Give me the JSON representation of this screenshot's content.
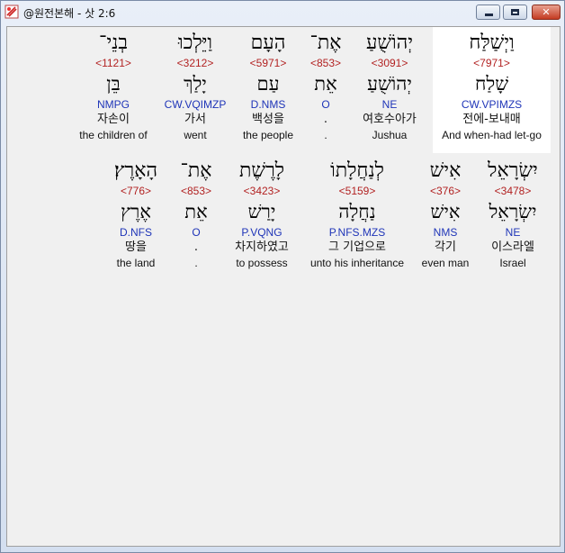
{
  "window": {
    "title": "@원전본해 - 삿 2:6",
    "buttons": {
      "minimize": "",
      "maximize": "",
      "close": "✕"
    }
  },
  "verse": {
    "row1": [
      {
        "heb": "וַיְשַׁלַּח",
        "strong": "<7971>",
        "lemma": "שָׁלַח",
        "morph": "CW.VPIMZS",
        "kor": "전에-보내매",
        "eng": "And when-had let-go"
      },
      {
        "heb": "יְהוֹשֻׁעַ",
        "strong": "<3091>",
        "lemma": "יְהוֹשֻׁעַ",
        "morph": "NE",
        "kor": "여호수아가",
        "eng": "Jushua"
      },
      {
        "heb": "אֶת־",
        "strong": "<853>",
        "lemma": "אֵת",
        "morph": "O",
        "kor": ".",
        "eng": "."
      },
      {
        "heb": "הָעָם",
        "strong": "<5971>",
        "lemma": "עַם",
        "morph": "D.NMS",
        "kor": "백성을",
        "eng": "the people"
      },
      {
        "heb": "וַיֵּלְכוּ",
        "strong": "<3212>",
        "lemma": "יָלַךְ",
        "morph": "CW.VQIMZP",
        "kor": "가서",
        "eng": "went"
      },
      {
        "heb": "בְנֵי־",
        "strong": "<1121>",
        "lemma": "בֵּן",
        "morph": "NMPG",
        "kor": "자손이",
        "eng": "the children of"
      }
    ],
    "row2": [
      {
        "heb": "יִשְׂרָאֵל",
        "strong": "<3478>",
        "lemma": "יִשְׂרָאֵל",
        "morph": "NE",
        "kor": "이스라엘",
        "eng": "Israel"
      },
      {
        "heb": "אִישׁ",
        "strong": "<376>",
        "lemma": "אִישׁ",
        "morph": "NMS",
        "kor": "각기",
        "eng": "even man"
      },
      {
        "heb": "לְנַחֲלָתוֹ",
        "strong": "<5159>",
        "lemma": "נַחֲלָה",
        "morph": "P.NFS.MZS",
        "kor": "그 기업으로",
        "eng": "unto his inheritance"
      },
      {
        "heb": "לָרֶשֶׁת",
        "strong": "<3423>",
        "lemma": "יָרַשׁ",
        "morph": "P.VQNG",
        "kor": "차지하였고",
        "eng": "to possess"
      },
      {
        "heb": "אֶת־",
        "strong": "<853>",
        "lemma": "אֵת",
        "morph": "O",
        "kor": ".",
        "eng": "."
      },
      {
        "heb": "הָאָרֶץ׃",
        "strong": "<776>",
        "lemma": "אֶרֶץ",
        "morph": "D.NFS",
        "kor": "땅을",
        "eng": "the land"
      }
    ]
  }
}
